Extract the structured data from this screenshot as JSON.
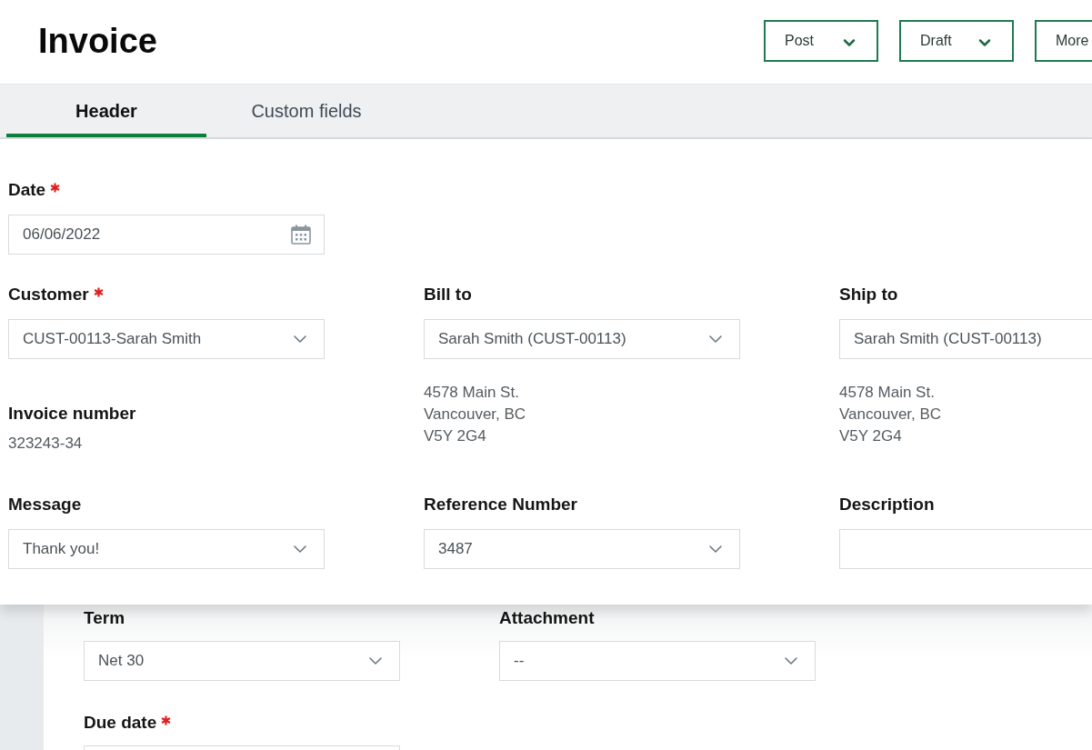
{
  "page": {
    "title": "Invoice"
  },
  "actions": [
    {
      "label": "Post",
      "kind": "dropdown"
    },
    {
      "label": "Draft",
      "kind": "dropdown"
    },
    {
      "label": "More",
      "kind": "plain"
    }
  ],
  "tabs": [
    {
      "label": "Header",
      "selected": true
    },
    {
      "label": "Custom fields",
      "selected": false
    }
  ],
  "header_form": {
    "rows": [
      [
        {
          "kind": "date",
          "label": "Date",
          "required": true,
          "value": "06/06/2022"
        }
      ],
      [
        {
          "kind": "select",
          "label": "Customer",
          "required": true,
          "value": "CUST-00113-Sarah Smith"
        },
        {
          "kind": "select",
          "label": "Bill to",
          "required": false,
          "value": "Sarah Smith (CUST-00113)"
        },
        {
          "kind": "text",
          "label": "Ship to",
          "required": false,
          "value": "Sarah Smith (CUST-00113)"
        }
      ],
      [
        {
          "kind": "static",
          "label": "Invoice number",
          "required": false,
          "value": "323243-34"
        },
        {
          "kind": "address",
          "lines": [
            "4578 Main St.",
            "Vancouver, BC",
            "V5Y 2G4"
          ]
        },
        {
          "kind": "address",
          "lines": [
            "4578 Main St.",
            "Vancouver, BC",
            "V5Y 2G4"
          ]
        }
      ],
      [
        {
          "kind": "select",
          "label": "Message",
          "required": false,
          "value": "Thank you!"
        },
        {
          "kind": "select",
          "label": "Reference Number",
          "required": false,
          "value": "3487"
        },
        {
          "kind": "text",
          "label": "Description",
          "required": false
        }
      ]
    ]
  },
  "details_form": {
    "rows": [
      [
        {
          "kind": "select",
          "label": "Term",
          "required": false,
          "value": "Net 30"
        },
        {
          "kind": "select",
          "label": "Attachment",
          "required": false,
          "value": "--"
        }
      ],
      [
        {
          "kind": "text",
          "label": "Due date",
          "required": true
        }
      ]
    ]
  }
}
